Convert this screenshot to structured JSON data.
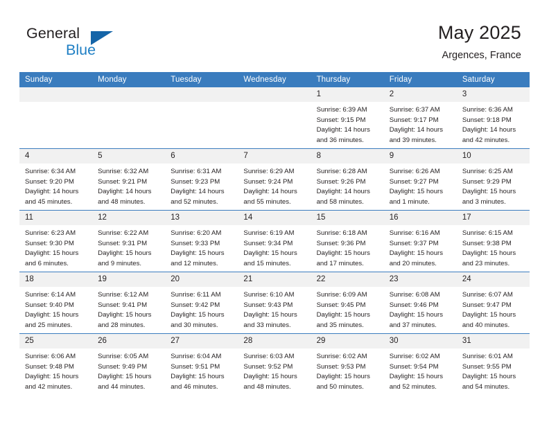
{
  "brand": {
    "word1": "General",
    "word2": "Blue",
    "triangle_color": "#1565a8",
    "blue_text_color": "#1f7fc4"
  },
  "header": {
    "title": "May 2025",
    "subtitle": "Argences, France"
  },
  "theme": {
    "header_bg": "#3a7cbe",
    "header_text": "#ffffff",
    "daynum_bg": "#f1f1f1",
    "grid_line": "#3a7cbe",
    "body_text": "#231f20"
  },
  "weekday_headers": [
    "Sunday",
    "Monday",
    "Tuesday",
    "Wednesday",
    "Thursday",
    "Friday",
    "Saturday"
  ],
  "weeks": [
    [
      {
        "day": "",
        "empty": true,
        "sunrise": "",
        "sunset": "",
        "daylight1": "",
        "daylight2": ""
      },
      {
        "day": "",
        "empty": true,
        "sunrise": "",
        "sunset": "",
        "daylight1": "",
        "daylight2": ""
      },
      {
        "day": "",
        "empty": true,
        "sunrise": "",
        "sunset": "",
        "daylight1": "",
        "daylight2": ""
      },
      {
        "day": "",
        "empty": true,
        "sunrise": "",
        "sunset": "",
        "daylight1": "",
        "daylight2": ""
      },
      {
        "day": "1",
        "empty": false,
        "sunrise": "Sunrise: 6:39 AM",
        "sunset": "Sunset: 9:15 PM",
        "daylight1": "Daylight: 14 hours",
        "daylight2": "and 36 minutes."
      },
      {
        "day": "2",
        "empty": false,
        "sunrise": "Sunrise: 6:37 AM",
        "sunset": "Sunset: 9:17 PM",
        "daylight1": "Daylight: 14 hours",
        "daylight2": "and 39 minutes."
      },
      {
        "day": "3",
        "empty": false,
        "sunrise": "Sunrise: 6:36 AM",
        "sunset": "Sunset: 9:18 PM",
        "daylight1": "Daylight: 14 hours",
        "daylight2": "and 42 minutes."
      }
    ],
    [
      {
        "day": "4",
        "empty": false,
        "sunrise": "Sunrise: 6:34 AM",
        "sunset": "Sunset: 9:20 PM",
        "daylight1": "Daylight: 14 hours",
        "daylight2": "and 45 minutes."
      },
      {
        "day": "5",
        "empty": false,
        "sunrise": "Sunrise: 6:32 AM",
        "sunset": "Sunset: 9:21 PM",
        "daylight1": "Daylight: 14 hours",
        "daylight2": "and 48 minutes."
      },
      {
        "day": "6",
        "empty": false,
        "sunrise": "Sunrise: 6:31 AM",
        "sunset": "Sunset: 9:23 PM",
        "daylight1": "Daylight: 14 hours",
        "daylight2": "and 52 minutes."
      },
      {
        "day": "7",
        "empty": false,
        "sunrise": "Sunrise: 6:29 AM",
        "sunset": "Sunset: 9:24 PM",
        "daylight1": "Daylight: 14 hours",
        "daylight2": "and 55 minutes."
      },
      {
        "day": "8",
        "empty": false,
        "sunrise": "Sunrise: 6:28 AM",
        "sunset": "Sunset: 9:26 PM",
        "daylight1": "Daylight: 14 hours",
        "daylight2": "and 58 minutes."
      },
      {
        "day": "9",
        "empty": false,
        "sunrise": "Sunrise: 6:26 AM",
        "sunset": "Sunset: 9:27 PM",
        "daylight1": "Daylight: 15 hours",
        "daylight2": "and 1 minute."
      },
      {
        "day": "10",
        "empty": false,
        "sunrise": "Sunrise: 6:25 AM",
        "sunset": "Sunset: 9:29 PM",
        "daylight1": "Daylight: 15 hours",
        "daylight2": "and 3 minutes."
      }
    ],
    [
      {
        "day": "11",
        "empty": false,
        "sunrise": "Sunrise: 6:23 AM",
        "sunset": "Sunset: 9:30 PM",
        "daylight1": "Daylight: 15 hours",
        "daylight2": "and 6 minutes."
      },
      {
        "day": "12",
        "empty": false,
        "sunrise": "Sunrise: 6:22 AM",
        "sunset": "Sunset: 9:31 PM",
        "daylight1": "Daylight: 15 hours",
        "daylight2": "and 9 minutes."
      },
      {
        "day": "13",
        "empty": false,
        "sunrise": "Sunrise: 6:20 AM",
        "sunset": "Sunset: 9:33 PM",
        "daylight1": "Daylight: 15 hours",
        "daylight2": "and 12 minutes."
      },
      {
        "day": "14",
        "empty": false,
        "sunrise": "Sunrise: 6:19 AM",
        "sunset": "Sunset: 9:34 PM",
        "daylight1": "Daylight: 15 hours",
        "daylight2": "and 15 minutes."
      },
      {
        "day": "15",
        "empty": false,
        "sunrise": "Sunrise: 6:18 AM",
        "sunset": "Sunset: 9:36 PM",
        "daylight1": "Daylight: 15 hours",
        "daylight2": "and 17 minutes."
      },
      {
        "day": "16",
        "empty": false,
        "sunrise": "Sunrise: 6:16 AM",
        "sunset": "Sunset: 9:37 PM",
        "daylight1": "Daylight: 15 hours",
        "daylight2": "and 20 minutes."
      },
      {
        "day": "17",
        "empty": false,
        "sunrise": "Sunrise: 6:15 AM",
        "sunset": "Sunset: 9:38 PM",
        "daylight1": "Daylight: 15 hours",
        "daylight2": "and 23 minutes."
      }
    ],
    [
      {
        "day": "18",
        "empty": false,
        "sunrise": "Sunrise: 6:14 AM",
        "sunset": "Sunset: 9:40 PM",
        "daylight1": "Daylight: 15 hours",
        "daylight2": "and 25 minutes."
      },
      {
        "day": "19",
        "empty": false,
        "sunrise": "Sunrise: 6:12 AM",
        "sunset": "Sunset: 9:41 PM",
        "daylight1": "Daylight: 15 hours",
        "daylight2": "and 28 minutes."
      },
      {
        "day": "20",
        "empty": false,
        "sunrise": "Sunrise: 6:11 AM",
        "sunset": "Sunset: 9:42 PM",
        "daylight1": "Daylight: 15 hours",
        "daylight2": "and 30 minutes."
      },
      {
        "day": "21",
        "empty": false,
        "sunrise": "Sunrise: 6:10 AM",
        "sunset": "Sunset: 9:43 PM",
        "daylight1": "Daylight: 15 hours",
        "daylight2": "and 33 minutes."
      },
      {
        "day": "22",
        "empty": false,
        "sunrise": "Sunrise: 6:09 AM",
        "sunset": "Sunset: 9:45 PM",
        "daylight1": "Daylight: 15 hours",
        "daylight2": "and 35 minutes."
      },
      {
        "day": "23",
        "empty": false,
        "sunrise": "Sunrise: 6:08 AM",
        "sunset": "Sunset: 9:46 PM",
        "daylight1": "Daylight: 15 hours",
        "daylight2": "and 37 minutes."
      },
      {
        "day": "24",
        "empty": false,
        "sunrise": "Sunrise: 6:07 AM",
        "sunset": "Sunset: 9:47 PM",
        "daylight1": "Daylight: 15 hours",
        "daylight2": "and 40 minutes."
      }
    ],
    [
      {
        "day": "25",
        "empty": false,
        "sunrise": "Sunrise: 6:06 AM",
        "sunset": "Sunset: 9:48 PM",
        "daylight1": "Daylight: 15 hours",
        "daylight2": "and 42 minutes."
      },
      {
        "day": "26",
        "empty": false,
        "sunrise": "Sunrise: 6:05 AM",
        "sunset": "Sunset: 9:49 PM",
        "daylight1": "Daylight: 15 hours",
        "daylight2": "and 44 minutes."
      },
      {
        "day": "27",
        "empty": false,
        "sunrise": "Sunrise: 6:04 AM",
        "sunset": "Sunset: 9:51 PM",
        "daylight1": "Daylight: 15 hours",
        "daylight2": "and 46 minutes."
      },
      {
        "day": "28",
        "empty": false,
        "sunrise": "Sunrise: 6:03 AM",
        "sunset": "Sunset: 9:52 PM",
        "daylight1": "Daylight: 15 hours",
        "daylight2": "and 48 minutes."
      },
      {
        "day": "29",
        "empty": false,
        "sunrise": "Sunrise: 6:02 AM",
        "sunset": "Sunset: 9:53 PM",
        "daylight1": "Daylight: 15 hours",
        "daylight2": "and 50 minutes."
      },
      {
        "day": "30",
        "empty": false,
        "sunrise": "Sunrise: 6:02 AM",
        "sunset": "Sunset: 9:54 PM",
        "daylight1": "Daylight: 15 hours",
        "daylight2": "and 52 minutes."
      },
      {
        "day": "31",
        "empty": false,
        "sunrise": "Sunrise: 6:01 AM",
        "sunset": "Sunset: 9:55 PM",
        "daylight1": "Daylight: 15 hours",
        "daylight2": "and 54 minutes."
      }
    ]
  ]
}
